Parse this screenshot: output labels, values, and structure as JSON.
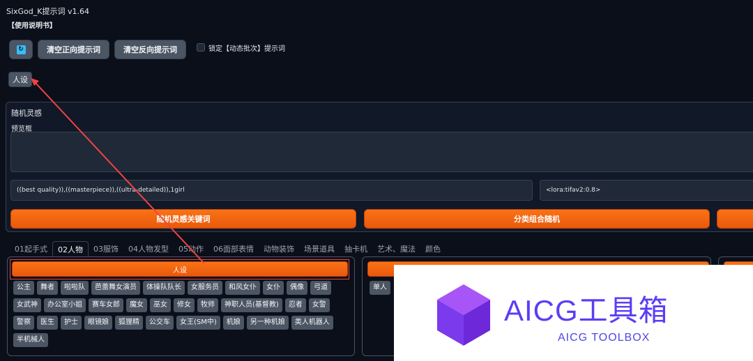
{
  "app": {
    "title": "SixGod_K提示词 v1.64",
    "manual_label": "【使用说明书】"
  },
  "toolbar": {
    "refresh_icon": "refresh-icon",
    "clear_positive_label": "清空正向提示词",
    "clear_negative_label": "清空反向提示词",
    "lock_label": "锁定【动态批次】提示词",
    "persona_button_label": "人设"
  },
  "random_panel": {
    "title": "随机灵感",
    "preview_label": "预览框",
    "prompt_value": "((best quality)),((masterpiece)),((ultra-detailed)),1girl",
    "lora_value": "<lora:tifav2:0.8>",
    "keyword_button_label": "随机灵感关键词",
    "category_button_label": "分类组合随机"
  },
  "tabs": [
    {
      "label": "01起手式",
      "active": false
    },
    {
      "label": "02人物",
      "active": true
    },
    {
      "label": "03服饰",
      "active": false
    },
    {
      "label": "04人物发型",
      "active": false
    },
    {
      "label": "05动作",
      "active": false
    },
    {
      "label": "06面部表情",
      "active": false
    },
    {
      "label": "动物装饰",
      "active": false
    },
    {
      "label": "场景道具",
      "active": false
    },
    {
      "label": "抽卡机",
      "active": false
    },
    {
      "label": "艺术、魔法",
      "active": false
    },
    {
      "label": "颜色",
      "active": false
    }
  ],
  "persona_group": {
    "header_label": "人设",
    "chips": [
      "公主",
      "舞者",
      "啦啦队",
      "芭蕾舞女演员",
      "体操队队长",
      "女服务员",
      "和风女仆",
      "女仆",
      "偶像",
      "弓道",
      "女武神",
      "办公室小姐",
      "赛车女郎",
      "魔女",
      "巫女",
      "修女",
      "牧师",
      "神职人员(基督教)",
      "忍者",
      "女警",
      "警察",
      "医生",
      "护士",
      "眼镜娘",
      "狐狸精",
      "公交车",
      "女王(SM中)",
      "机娘",
      "另一种机娘",
      "类人机器人",
      "半机械人"
    ]
  },
  "second_group": {
    "chip_label": "单人"
  },
  "watermark": {
    "title": "AICG工具箱",
    "subtitle": "AICG TOOLBOX"
  },
  "colors": {
    "accent": "#f97316",
    "annotation": "#ef4444",
    "brand": "#5b3df5"
  }
}
